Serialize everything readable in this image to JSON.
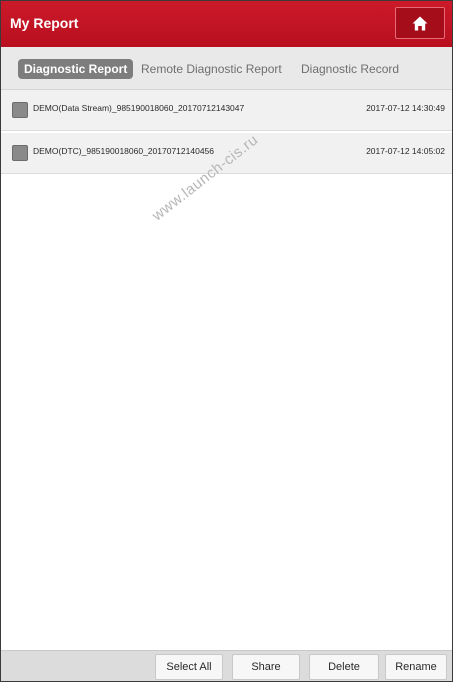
{
  "header": {
    "title": "My Report",
    "home_icon": "home-icon"
  },
  "tabs": [
    {
      "label": "Diagnostic Report",
      "active": true
    },
    {
      "label": "Remote Diagnostic Report",
      "active": false
    },
    {
      "label": "Diagnostic Record",
      "active": false
    }
  ],
  "reports": [
    {
      "name": "DEMO(Data Stream)_985190018060_20170712143047",
      "date": "2017-07-12 14:30:49",
      "checked": false
    },
    {
      "name": "DEMO(DTC)_985190018060_20170712140456",
      "date": "2017-07-12 14:05:02",
      "checked": false
    }
  ],
  "watermark": "www.launch-cis.ru",
  "toolbar": {
    "select_all": "Select All",
    "share": "Share",
    "delete": "Delete",
    "rename": "Rename"
  },
  "colors": {
    "header_red": "#c4162a",
    "active_tab_bg": "#7d7d7d",
    "row_bg": "#f1f1f1",
    "toolbar_bg": "#dcdcdc"
  }
}
